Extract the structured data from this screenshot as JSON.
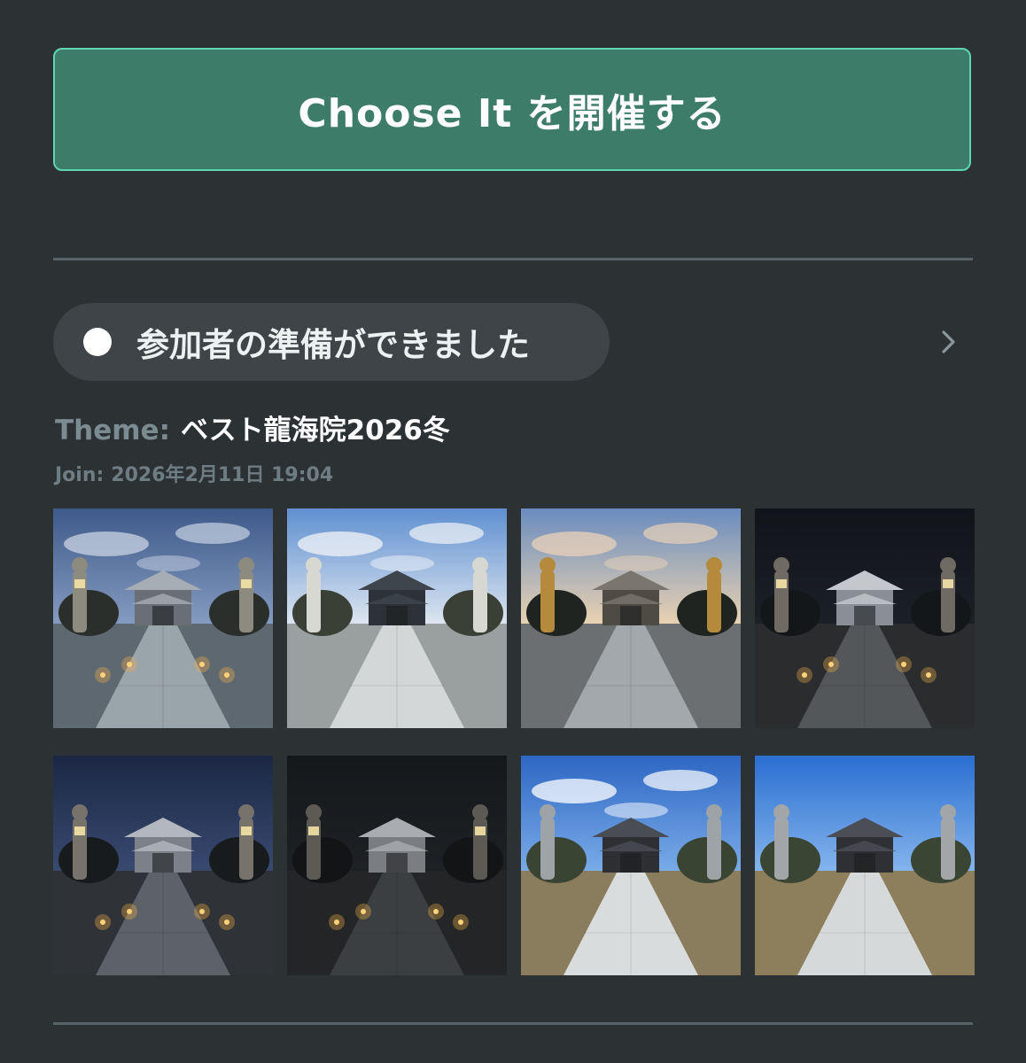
{
  "host_button": {
    "label": "Choose It を開催する"
  },
  "status": {
    "text": "参加者の準備ができました"
  },
  "theme": {
    "label": "Theme:",
    "value": "ベスト龍海院2026冬"
  },
  "join": {
    "label": "Join:",
    "value": "2026年2月11日 19:04"
  },
  "photos": [
    {
      "scene": "dusk-lanterns"
    },
    {
      "scene": "morning-gate"
    },
    {
      "scene": "sunset-statues"
    },
    {
      "scene": "night-lanterns"
    },
    {
      "scene": "blue-hour-lanterns"
    },
    {
      "scene": "night-dark"
    },
    {
      "scene": "day-cloudy-blue"
    },
    {
      "scene": "day-clear-blue"
    }
  ],
  "colors": {
    "background": "#2c3134",
    "button_fill": "#3d7c69",
    "button_border": "#5ed5b0",
    "pill": "#3e4447",
    "muted_text": "#7b8b92"
  }
}
